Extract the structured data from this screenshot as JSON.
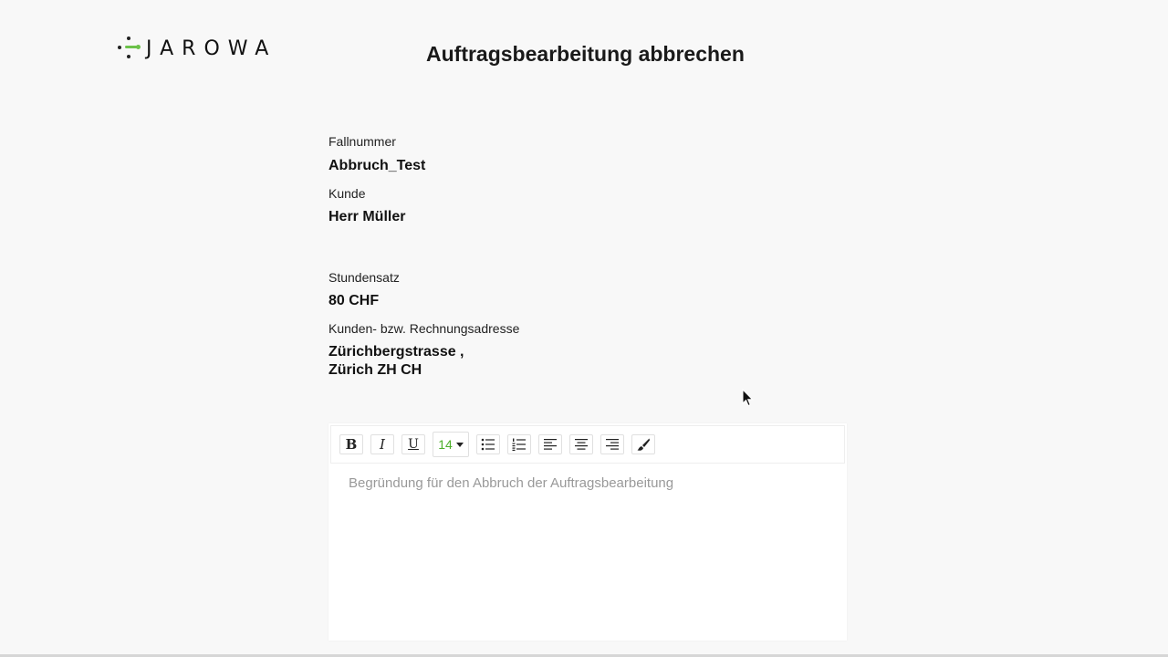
{
  "brand": {
    "name": "JAROWA",
    "accent": "#6cc24a"
  },
  "page": {
    "title": "Auftragsbearbeitung abbrechen"
  },
  "fields": {
    "fallnummer": {
      "label": "Fallnummer",
      "value": "Abbruch_Test"
    },
    "kunde": {
      "label": "Kunde",
      "value": "Herr Müller"
    },
    "stundensatz": {
      "label": "Stundensatz",
      "value": "80 CHF"
    },
    "adresse": {
      "label": "Kunden- bzw. Rechnungsadresse",
      "line1": "Zürichbergstrasse ,",
      "line2": "Zürich ZH CH"
    }
  },
  "editor": {
    "toolbar": {
      "bold": "B",
      "italic": "I",
      "underline": "U",
      "font_size": "14",
      "icons": [
        "bullet-list-icon",
        "numbered-list-icon",
        "align-left-icon",
        "align-center-icon",
        "align-right-icon",
        "brush-icon"
      ]
    },
    "placeholder": "Begründung für den Abbruch der Auftragsbearbeitung"
  }
}
